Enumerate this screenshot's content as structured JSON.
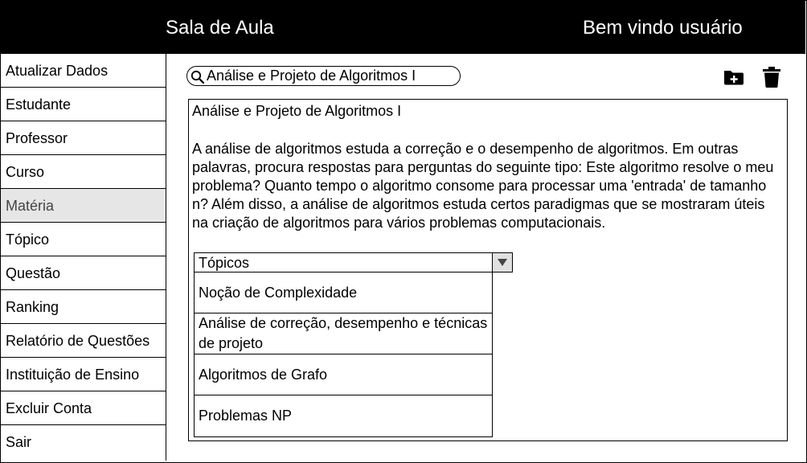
{
  "header": {
    "title": "Sala de Aula",
    "welcome": "Bem vindo usuário"
  },
  "sidebar": {
    "items": [
      {
        "label": "Atualizar Dados"
      },
      {
        "label": "Estudante"
      },
      {
        "label": "Professor"
      },
      {
        "label": "Curso"
      },
      {
        "label": "Matéria",
        "active": true
      },
      {
        "label": "Tópico"
      },
      {
        "label": "Questão"
      },
      {
        "label": "Ranking"
      },
      {
        "label": "Relatório de Questões"
      },
      {
        "label": "Instituição de Ensino"
      },
      {
        "label": "Excluir Conta"
      },
      {
        "label": "Sair"
      }
    ]
  },
  "search": {
    "value": "Análise e Projeto de Algoritmos I",
    "icon": "search-icon"
  },
  "toolbar": {
    "add_icon": "folder-add-icon",
    "delete_icon": "trash-icon"
  },
  "content": {
    "title": "Análise e Projeto de Algoritmos I",
    "description_lines": [
      "A análise de algoritmos estuda a correção e o desempenho de algoritmos.  Em outras",
      "palavras, procura respostas para perguntas do seguinte tipo:  Este algoritmo resolve o meu",
      "problema?  Quanto tempo o algoritmo consome para processar uma 'entrada' de tamanho",
      "n? Além disso, a análise de algoritmos estuda certos paradigmas que se mostraram úteis",
      "na criação de algoritmos para vários problemas computacionais."
    ]
  },
  "topics": {
    "label": "Tópicos",
    "items": [
      "Noção de Complexidade",
      "Análise de correção, desempenho e técnicas de projeto",
      "Algoritmos de Grafo",
      "Problemas NP"
    ]
  }
}
